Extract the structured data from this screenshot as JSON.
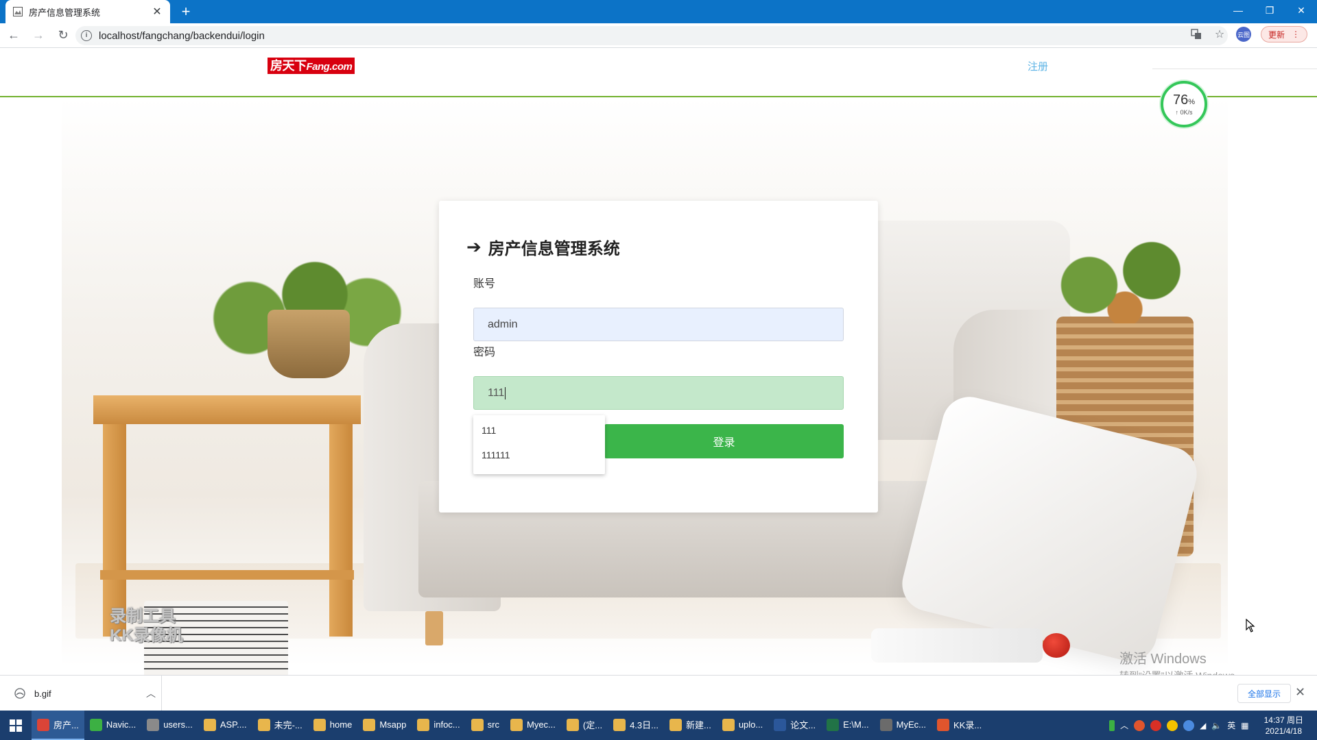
{
  "browser": {
    "tab_title": "房产信息管理系统",
    "url": "localhost/fangchang/backendui/login",
    "update_label": "更新",
    "avatar_label": "云图"
  },
  "site": {
    "logo_text": "房天下",
    "logo_sub": "Fang.com",
    "register_link": "注册"
  },
  "login": {
    "title": "房产信息管理系统",
    "account_label": "账号",
    "account_value": "admin",
    "password_label": "密码",
    "password_value": "111",
    "login_button": "登录",
    "autocomplete_options": [
      "111",
      "111111"
    ]
  },
  "speed_widget": {
    "percent": "76",
    "percent_unit": "%",
    "rate": "↑ 0K/s"
  },
  "watermark": {
    "line1": "录制工具",
    "line2": "KK录像机"
  },
  "windows_activation": {
    "title": "激活 Windows",
    "subtitle": "转到“设置”以激活 Windows。"
  },
  "download_bar": {
    "file_name": "b.gif",
    "show_all": "全部显示"
  },
  "taskbar": {
    "items": [
      {
        "label": "房产...",
        "color": "#db4437"
      },
      {
        "label": "Navic...",
        "color": "#3cb043"
      },
      {
        "label": "users...",
        "color": "#8a8a8a"
      },
      {
        "label": "ASP....",
        "color": "#e8b64c"
      },
      {
        "label": "未完-...",
        "color": "#e8b64c"
      },
      {
        "label": "home",
        "color": "#e8b64c"
      },
      {
        "label": "Msapp",
        "color": "#e8b64c"
      },
      {
        "label": "infoc...",
        "color": "#e8b64c"
      },
      {
        "label": "src",
        "color": "#e8b64c"
      },
      {
        "label": "Myec...",
        "color": "#e8b64c"
      },
      {
        "label": "(定...",
        "color": "#e8b64c"
      },
      {
        "label": "4.3日...",
        "color": "#e8b64c"
      },
      {
        "label": "新建...",
        "color": "#e8b64c"
      },
      {
        "label": "uplo...",
        "color": "#e8b64c"
      },
      {
        "label": "论文...",
        "color": "#2b579a"
      },
      {
        "label": "E:\\M...",
        "color": "#217346"
      },
      {
        "label": "MyEc...",
        "color": "#6b6b6b"
      },
      {
        "label": "KK录...",
        "color": "#e0552d"
      }
    ],
    "ime": "英",
    "time": "14:37 周日",
    "date": "2021/4/18"
  }
}
